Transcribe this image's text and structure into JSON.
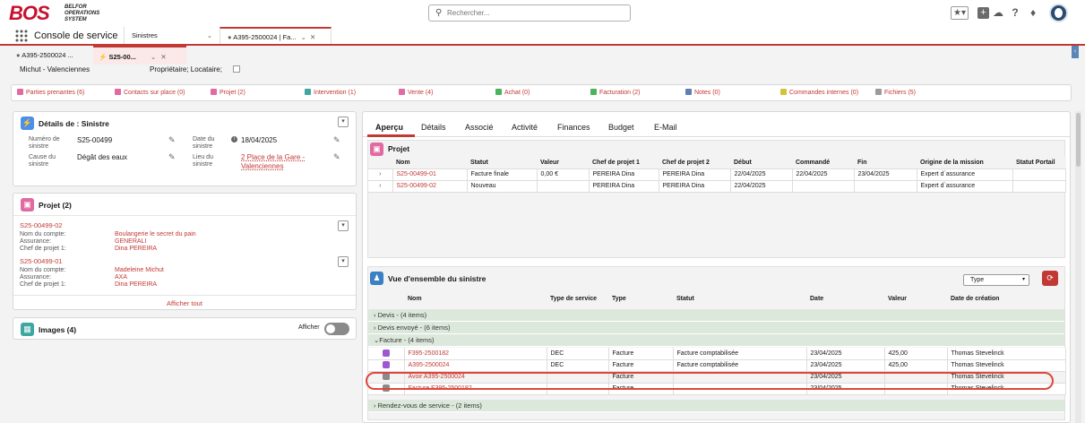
{
  "brand": {
    "logo_text": "BOS",
    "logo_subtitle": [
      "BELFOR",
      "OPERATIONS",
      "SYSTEM"
    ],
    "color": "#c8102e"
  },
  "search": {
    "placeholder": "Rechercher..."
  },
  "header_icons": [
    "favorites-star-icon",
    "add-icon",
    "trailhead-icon",
    "help-icon",
    "notifications-bell-icon",
    "avatar"
  ],
  "nav": {
    "app_name": "Console de service",
    "tabs": [
      {
        "label": "Sinistres"
      },
      {
        "label": "A395-2500024 | Fa..."
      }
    ]
  },
  "subtabs": [
    {
      "label": "A395-2500024 ..."
    },
    {
      "label": "S25-00..."
    }
  ],
  "strip": {
    "left": "Michut - Valenciennes",
    "right": "Propriétaire; Locataire;"
  },
  "related": [
    {
      "label": "Parties prenantes (6)",
      "color": "#e06aa1"
    },
    {
      "label": "Contacts sur place (0)",
      "color": "#e06aa1"
    },
    {
      "label": "Projet (2)",
      "color": "#e06aa1"
    },
    {
      "label": "Intervention (1)",
      "color": "#3fa6a0"
    },
    {
      "label": "Vente (4)",
      "color": "#e06aa1"
    },
    {
      "label": "Achat (0)",
      "color": "#4bb35a"
    },
    {
      "label": "Facturation (2)",
      "color": "#4bb35a"
    },
    {
      "label": "Notes (0)",
      "color": "#5f7fb5"
    },
    {
      "label": "Commandes internes (0)",
      "color": "#d4c33a"
    },
    {
      "label": "Fichiers (5)",
      "color": "#9b9b9b"
    }
  ],
  "details": {
    "title": "Détails de : Sinistre",
    "numero_label": "Numéro de sinistre",
    "numero_value": "S25-00499",
    "cause_label": "Cause du sinistre",
    "cause_value": "Dégât des eaux",
    "date_label": "Date du sinistre",
    "date_value": "18/04/2025",
    "lieu_label": "Lieu du sinistre",
    "lieu_value": "2 Place de la Gare - Valenciennes"
  },
  "projet_card": {
    "title": "Projet (2)",
    "items": [
      {
        "id": "S25-00499-02",
        "compte": "Boulangerie le secret du pain",
        "assurance": "GENERALI",
        "chef": "Dina PEREIRA"
      },
      {
        "id": "S25-00499-01",
        "compte": "Madeleine Michut",
        "assurance": "AXA",
        "chef": "Dina PEREIRA"
      }
    ],
    "labels": {
      "compte": "Nom du compte:",
      "assurance": "Assurance:",
      "chef": "Chef de projet 1:"
    },
    "show_all": "Afficher tout"
  },
  "images_card": {
    "title": "Images (4)",
    "toggle_label": "Afficher",
    "toggle_on": false
  },
  "main_tabs": [
    "Aperçu",
    "Détails",
    "Associé",
    "Activité",
    "Finances",
    "Budget",
    "E-Mail"
  ],
  "projet_table": {
    "title": "Projet",
    "headers": [
      "Nom",
      "Statut",
      "Valeur",
      "Chef de projet 1",
      "Chef de projet 2",
      "Début",
      "Commandé",
      "Fin",
      "Origine de la mission",
      "Statut Portail"
    ],
    "rows": [
      [
        "S25-00499-01",
        "Facture finale",
        "0,00 €",
        "PEREIRA Dina",
        "PEREIRA Dina",
        "22/04/2025",
        "22/04/2025",
        "23/04/2025",
        "Expert d`assurance",
        ""
      ],
      [
        "S25-00499-02",
        "Nouveau",
        "",
        "PEREIRA Dina",
        "PEREIRA Dina",
        "22/04/2025",
        "",
        "",
        "Expert d`assurance",
        ""
      ]
    ]
  },
  "vue": {
    "title": "Vue d'ensemble du sinistre",
    "filter_label": "Type",
    "headers": [
      "Nom",
      "Type de service",
      "Type",
      "Statut",
      "Date",
      "Valeur",
      "Date de création"
    ],
    "groups": [
      {
        "label": "Devis - (4 items)"
      },
      {
        "label": "Devis envoyé - (6 items)"
      },
      {
        "label": "Facture - (4 items)"
      },
      {
        "label": "Rendez-vous de service - (2 items)"
      }
    ],
    "rows": [
      [
        "F395-2500182",
        "DEC",
        "Facture",
        "Facture comptabilisée",
        "23/04/2025",
        "425,00",
        "Thomas Stevelinck"
      ],
      [
        "A395-2500024",
        "DEC",
        "Facture",
        "Facture comptabilisée",
        "23/04/2025",
        "425,00",
        "Thomas Stevelinck"
      ],
      [
        "Avoir A395-2500024",
        "",
        "Facture",
        "",
        "23/04/2025",
        "",
        "Thomas Stevelinck"
      ],
      [
        "Facture F395-2500182",
        "",
        "Facture",
        "",
        "23/04/2025",
        "",
        "Thomas Stevelinck"
      ]
    ]
  }
}
